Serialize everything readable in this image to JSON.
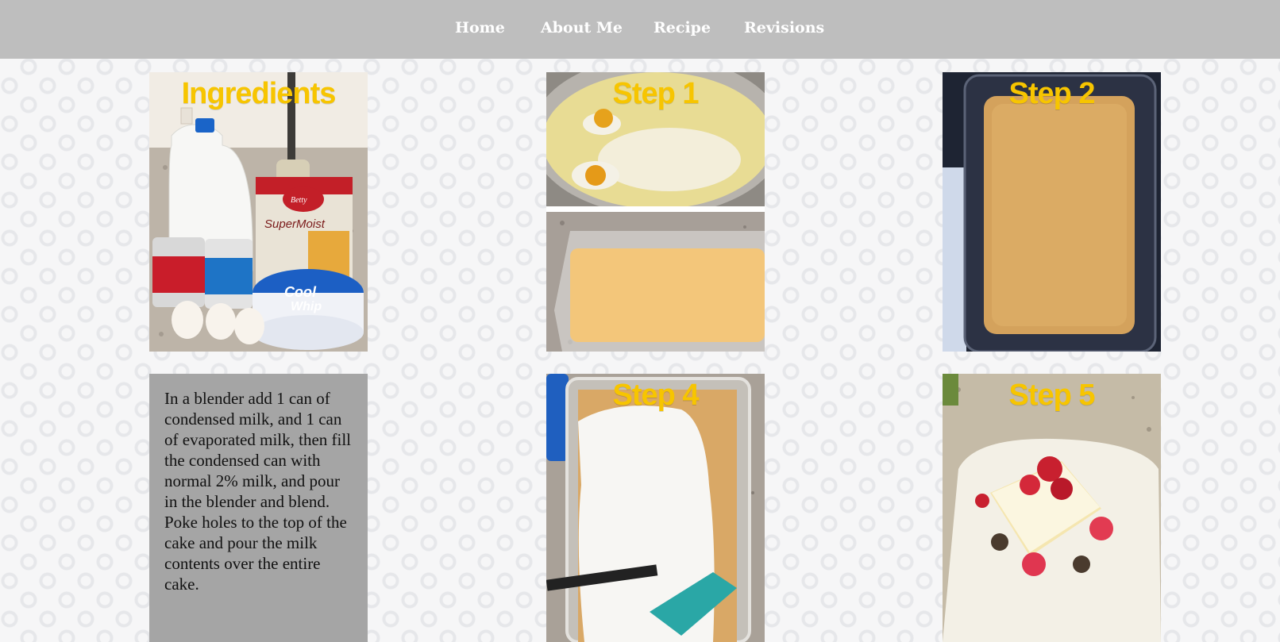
{
  "nav": {
    "items": [
      {
        "label": "Home"
      },
      {
        "label": "About Me"
      },
      {
        "label": "Recipe"
      },
      {
        "label": "Revisions"
      }
    ]
  },
  "tiles": {
    "ingredients": {
      "title": "Ingredients"
    },
    "step1": {
      "title": "Step 1"
    },
    "step2": {
      "title": "Step 2"
    },
    "step4": {
      "title": "Step 4"
    },
    "step5": {
      "title": "Step 5"
    }
  },
  "instructions": {
    "paragraph1": "In a blender add 1 can of condensed milk, and 1 can of evaporated milk, then fill the condensed can with normal 2% milk, and pour in the blender and blend.",
    "paragraph2": "Poke holes to the top of the cake and pour the milk contents over the entire cake."
  },
  "colors": {
    "nav_bg": "#bebebe",
    "title_yellow": "#f7c500",
    "text_panel_bg": "#a5a5a5"
  }
}
